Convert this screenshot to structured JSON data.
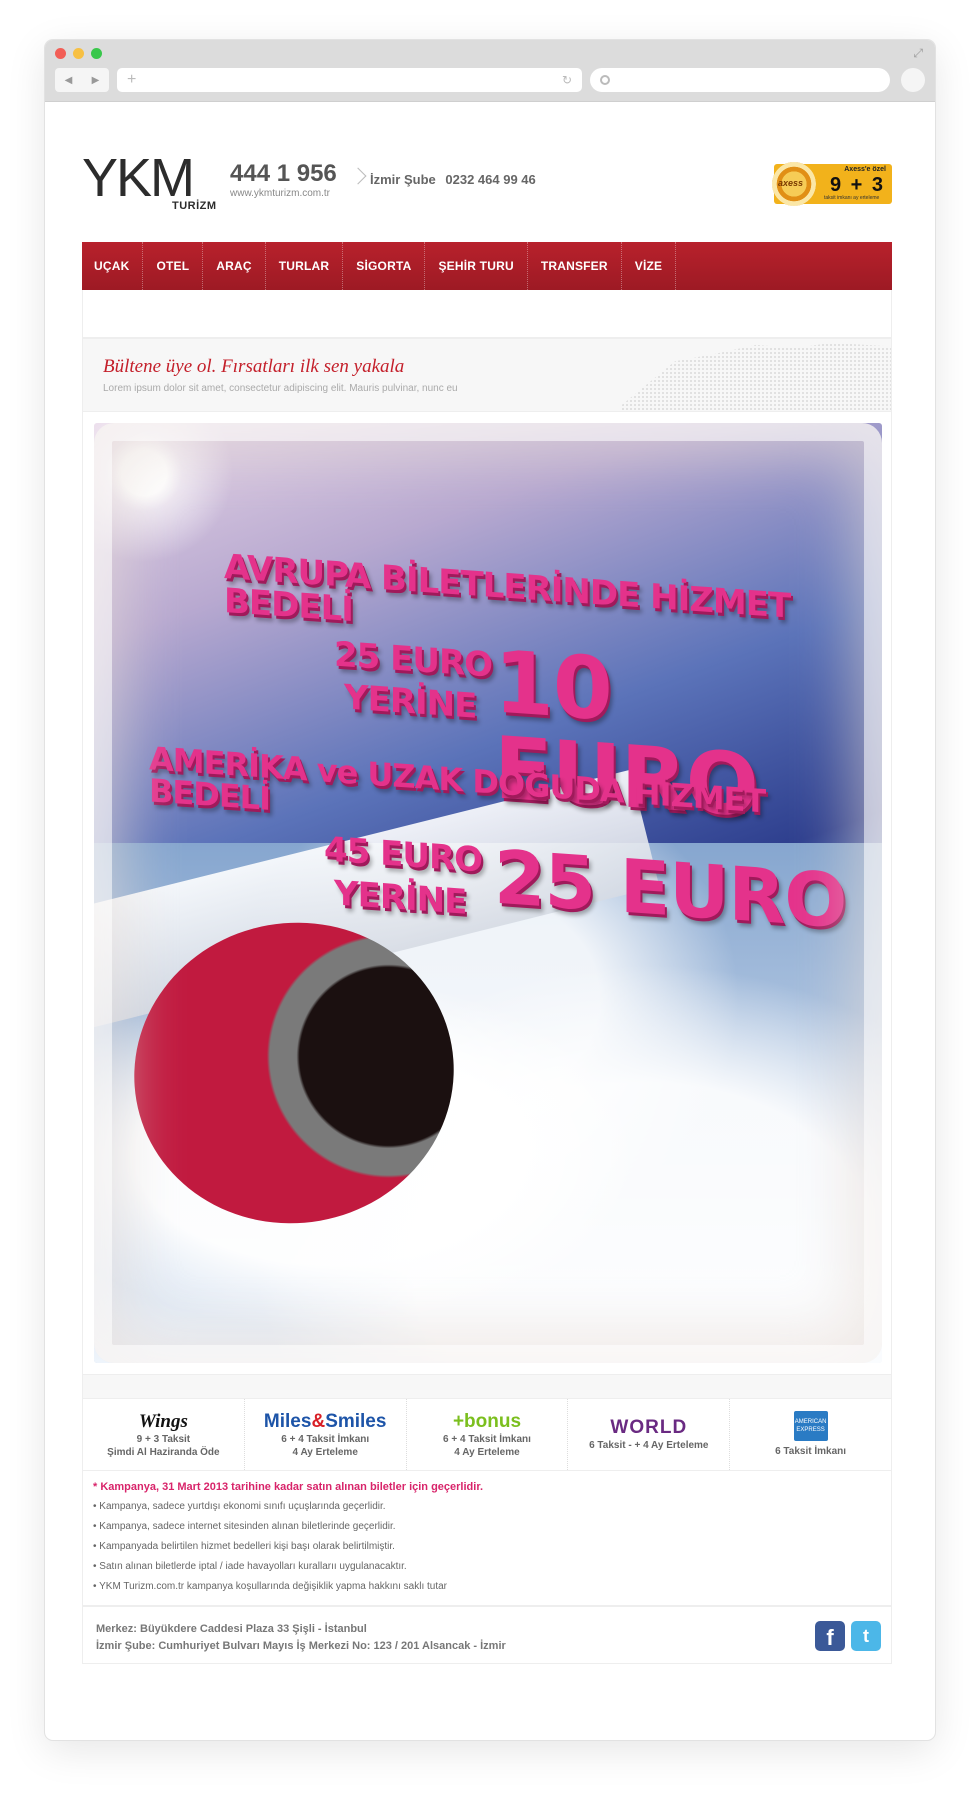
{
  "header": {
    "logo_letters": "YKM",
    "logo_sub": "TURİZM",
    "phone": "444 1 956",
    "website": "www.ykmturizm.com.tr",
    "branch_label": "İzmir Şube",
    "branch_phone": "0232 464 99 46",
    "axess": {
      "brand": "axess",
      "title": "Axess'e özel",
      "offer": "9 + 3",
      "small": "taksit imkanı   ay erteleme"
    }
  },
  "nav": [
    "UÇAK",
    "OTEL",
    "ARAÇ",
    "TURLAR",
    "SİGORTA",
    "ŞEHİR TURU",
    "TRANSFER",
    "VİZE"
  ],
  "bulletin": {
    "title": "Bültene üye ol. Fırsatları ilk sen yakala",
    "subtitle": "Lorem ipsum dolor sit amet, consectetur adipiscing elit. Mauris pulvinar, nunc eu"
  },
  "hero": {
    "line1": "AVRUPA BİLETLERİNDE HİZMET BEDELİ",
    "line2": "25 EURO",
    "line3": "YERİNE",
    "line4": "10 EURO",
    "line5": "AMERİKA ve UZAK DOĞUDA HİZMET BEDELİ",
    "line6": "45 EURO",
    "line7": "YERİNE",
    "line8": "25 EURO"
  },
  "cards": [
    {
      "brand": "Wings",
      "line1": "9 + 3 Taksit",
      "line2": "Şimdi Al Haziranda Öde"
    },
    {
      "brand_a": "Miles",
      "brand_amp": "&",
      "brand_b": "Smiles",
      "line1": "6 + 4 Taksit İmkanı",
      "line2": "4 Ay Erteleme"
    },
    {
      "brand": "+bonus",
      "line1": "6 + 4 Taksit İmkanı",
      "line2": "4 Ay Erteleme"
    },
    {
      "brand": "WORLD",
      "line1": "6 Taksit -  + 4 Ay Erteleme"
    },
    {
      "brand": "AMERICAN EXPRESS",
      "line1": "6 Taksit İmkanı"
    }
  ],
  "terms": {
    "lead": "* Kampanya, 31 Mart 2013 tarihine kadar satın alınan biletler için geçerlidir.",
    "items": [
      "• Kampanya, sadece yurtdışı ekonomi sınıfı uçuşlarında geçerlidir.",
      "• Kampanya, sadece internet sitesinden alınan biletlerinde geçerlidir.",
      "• Kampanyada belirtilen hizmet bedelleri kişi başı olarak belirtilmiştir.",
      "• Satın alınan biletlerde iptal / iade havayolları kurallarıı uygulanacaktır.",
      "• YKM Turizm.com.tr kampanya koşullarında değişiklik yapma hakkını saklı tutar"
    ]
  },
  "footer": {
    "line1": "Merkez: Büyükdere Caddesi Plaza 33 Şişli - İstanbul",
    "line2": "İzmir Şube: Cumhuriyet Bulvarı Mayıs İş Merkezi No: 123 / 201 Alsancak - İzmir",
    "fb": "f",
    "tw": "t"
  }
}
